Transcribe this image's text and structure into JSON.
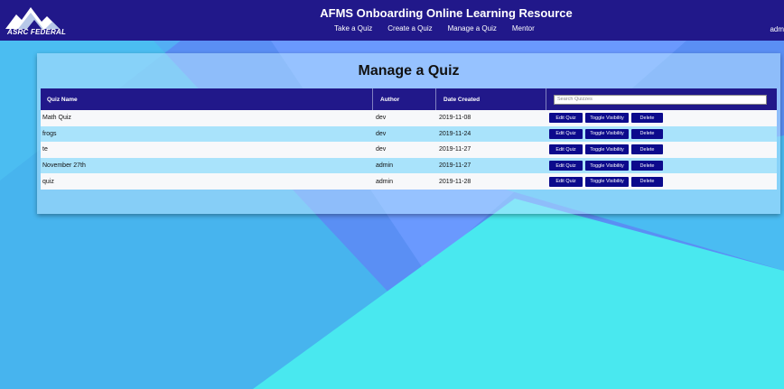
{
  "header": {
    "logo_text": "ASRC FEDERAL",
    "title": "AFMS Onboarding Online Learning Resource",
    "nav": [
      "Take a Quiz",
      "Create a Quiz",
      "Manage a Quiz",
      "Mentor"
    ],
    "user": "adm"
  },
  "main": {
    "title": "Manage a Quiz",
    "columns": [
      "Quiz Name",
      "Author",
      "Date Created"
    ],
    "search_placeholder": "Search Quizzes",
    "actions": {
      "edit": "Edit Quiz",
      "toggle": "Toggle Visibility",
      "delete": "Delete"
    },
    "rows": [
      {
        "name": "Math Quiz",
        "author": "dev",
        "date": "2019-11-08"
      },
      {
        "name": "frogs",
        "author": "dev",
        "date": "2019-11-24"
      },
      {
        "name": "te",
        "author": "dev",
        "date": "2019-11-27"
      },
      {
        "name": "November 27th",
        "author": "admin",
        "date": "2019-11-27"
      },
      {
        "name": "quiz",
        "author": "admin",
        "date": "2019-11-28"
      }
    ]
  },
  "colors": {
    "header_bg": "#21188a",
    "button_bg": "#0c0a8c",
    "row_alt": "#a9e3fb"
  }
}
